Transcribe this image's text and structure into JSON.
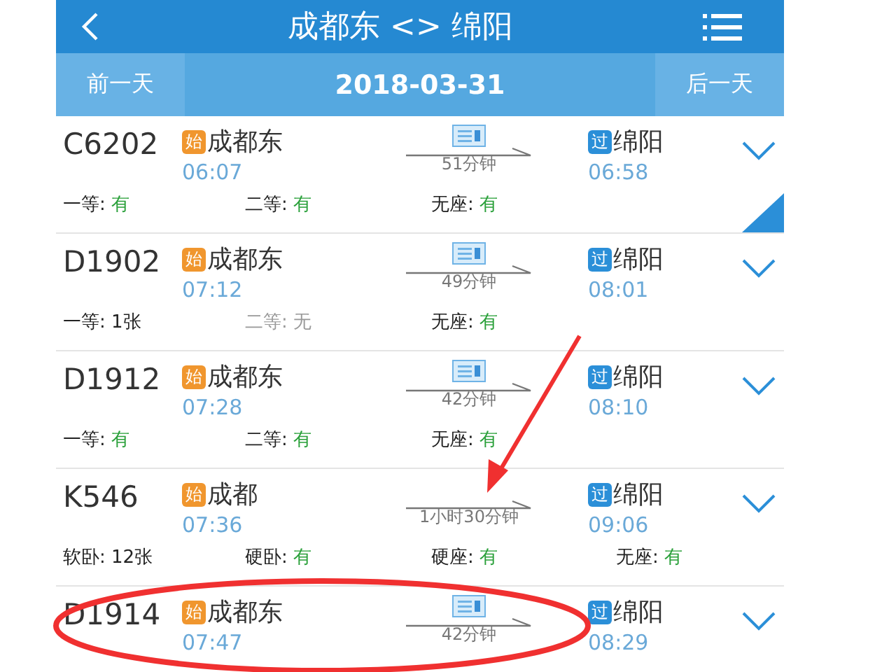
{
  "header": {
    "title": "成都东 <> 绵阳"
  },
  "date_bar": {
    "prev": "前一天",
    "date": "2018-03-31",
    "next": "后一天"
  },
  "trains": [
    {
      "number": "C6202",
      "from_badge": "始",
      "from": "成都东",
      "depart": "06:07",
      "e_ticket": true,
      "duration": "51分钟",
      "to_badge": "过",
      "to": "绵阳",
      "arrive": "06:58",
      "corner_ribbon": true,
      "seats": [
        {
          "label": "一等:",
          "value": "有",
          "kind": "plenty"
        },
        {
          "label": "二等:",
          "value": "有",
          "kind": "plenty"
        },
        {
          "label": "无座:",
          "value": "有",
          "kind": "plenty"
        }
      ]
    },
    {
      "number": "D1902",
      "from_badge": "始",
      "from": "成都东",
      "depart": "07:12",
      "e_ticket": true,
      "duration": "49分钟",
      "to_badge": "过",
      "to": "绵阳",
      "arrive": "08:01",
      "corner_ribbon": false,
      "seats": [
        {
          "label": "一等:",
          "value": "1张",
          "kind": "count"
        },
        {
          "label": "二等:",
          "value": "无",
          "kind": "none"
        },
        {
          "label": "无座:",
          "value": "有",
          "kind": "plenty"
        }
      ]
    },
    {
      "number": "D1912",
      "from_badge": "始",
      "from": "成都东",
      "depart": "07:28",
      "e_ticket": true,
      "duration": "42分钟",
      "to_badge": "过",
      "to": "绵阳",
      "arrive": "08:10",
      "corner_ribbon": false,
      "seats": [
        {
          "label": "一等:",
          "value": "有",
          "kind": "plenty"
        },
        {
          "label": "二等:",
          "value": "有",
          "kind": "plenty"
        },
        {
          "label": "无座:",
          "value": "有",
          "kind": "plenty"
        }
      ]
    },
    {
      "number": "K546",
      "from_badge": "始",
      "from": "成都",
      "depart": "07:36",
      "e_ticket": false,
      "duration": "1小时30分钟",
      "to_badge": "过",
      "to": "绵阳",
      "arrive": "09:06",
      "corner_ribbon": false,
      "seats": [
        {
          "label": "软卧:",
          "value": "12张",
          "kind": "count"
        },
        {
          "label": "硬卧:",
          "value": "有",
          "kind": "plenty"
        },
        {
          "label": "硬座:",
          "value": "有",
          "kind": "plenty"
        },
        {
          "label": "无座:",
          "value": "有",
          "kind": "plenty"
        }
      ]
    },
    {
      "number": "D1914",
      "from_badge": "始",
      "from": "成都东",
      "depart": "07:47",
      "e_ticket": true,
      "duration": "42分钟",
      "to_badge": "过",
      "to": "绵阳",
      "arrive": "08:29",
      "corner_ribbon": false
    }
  ]
}
